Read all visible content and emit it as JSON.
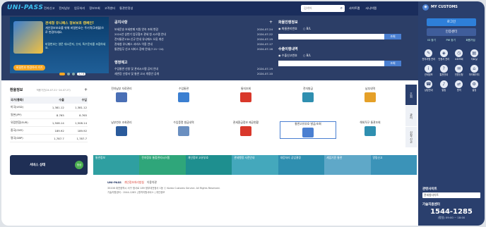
{
  "header": {
    "logo": "UNI-PASS",
    "nav": [
      "전자신고",
      "전자납부",
      "업무처리",
      "정보조회",
      "고객센터",
      "통관안정성"
    ],
    "search_placeholder": "검색어",
    "links": [
      "사이트맵",
      "시니어맵"
    ]
  },
  "promo": {
    "title": "관세청 유니패스 정보보호 캠페인!",
    "text": "개인정보보호를 위해 비밀번호는 주기적(3개월)으로 변경하세요.",
    "sub": "비밀번호는 영문 대소문자, 숫자, 특수문자를 조합하세요.",
    "button": "비밀번호 변경하러 가기",
    "pager": "1 / 3"
  },
  "notice": {
    "title": "공지사항",
    "items": [
      {
        "text": "보세운송 보세판매 지원 연속 조회 변경",
        "date": "2024-07-24"
      },
      {
        "text": "2024년 상반기 업무협조 관세 청 시스템 안내",
        "date": "2024-07-22"
      },
      {
        "text": "전자통관 EDI 신규 안내 유니패스 오류 개선",
        "date": "2024-07-19"
      },
      {
        "text": "관세청 유니패스 서비스 이용 안내",
        "date": "2024-07-17"
      },
      {
        "text": "통관업무 신고 서비스 장애 안내(7.21~24)",
        "date": "2024-07-16"
      }
    ]
  },
  "biz": {
    "title": "행정예고",
    "items": [
      {
        "text": "수입통관 신청 및 관리시스템 공지 안내",
        "date": "2024-07-19"
      },
      {
        "text": "세관장 신청서 및 통관 고시 개정안 공개",
        "date": "2024-07-10"
      }
    ]
  },
  "rates_panel": {
    "title1": "화물진행정보",
    "opts1": [
      "화물관리번호",
      "B/L"
    ],
    "go": "조회",
    "title2": "수출이행내역",
    "opts2": [
      "수출신고번호",
      "B/L"
    ]
  },
  "exchange": {
    "title": "환율정보",
    "date": "적용기간(24.07.21~24.07.27)",
    "headers": [
      "국가(통화)",
      "수출",
      "수입"
    ],
    "rows": [
      {
        "c": "미국(USD)",
        "e": "1,381.12",
        "i": "1,381.12"
      },
      {
        "c": "일본(JPY)",
        "e": "8.765",
        "i": "8.765"
      },
      {
        "c": "유럽연합(EUR)",
        "e": "1,508.14",
        "i": "1,508.14"
      },
      {
        "c": "중국(CNY)",
        "e": "189.92",
        "i": "189.92"
      },
      {
        "c": "영국(GBP)",
        "e": "1,787.7",
        "i": "1,787.7"
      }
    ]
  },
  "quick": [
    "전자납부\n자료관리",
    "수입통관",
    "통지조회",
    "전자발급",
    "납부내역",
    "납부번호\n조회관리",
    "수입증명\n발급내역",
    "관세환급정보\n제공현황",
    "통관고유부호\n발급/조회",
    "해외직구\n통관조회"
  ],
  "tabs": [
    "조회",
    "관리",
    "신청·신고"
  ],
  "service": {
    "label": "서비스 상태",
    "state": "정상"
  },
  "band": [
    "통관정보",
    "전자정부\n통합관리시스템",
    "개인정보\n고유부호",
    "관세행정\n사전안내",
    "대응처리\n공업결정",
    "세입기준\n통관",
    "알림신고"
  ],
  "sidebar": {
    "title": "MY CUSTOMS",
    "login": "로그인",
    "cert": "인증센터",
    "links": [
      "ID 찾기",
      "PW 찾기",
      "회원가입"
    ],
    "grid": [
      "전자서명\n관리",
      "인증서\n관리",
      "소요조회",
      "자료실",
      "관세정보",
      "통관안내",
      "민원신청",
      "마이페이지",
      "상담안내",
      "알림",
      "원격",
      "설정"
    ],
    "related_label": "관련사이트",
    "related_value": "관세청사이트",
    "center_label": "기술지원센터",
    "phone": "1544-1285",
    "hours": "(평일) 09:00 ~ 18:00"
  },
  "footer": {
    "brand": "UNI-PASS",
    "privacy": "개인정보처리방침",
    "terms": "이용약관",
    "addr": "35208 대전광역시 서구 청사로 189 정부대전청사 1동 ⓒ Korea Customs Service. All Rights Reserved.",
    "tel": "기술지원센터 : 1544-1285 | 원격지원서비스 | 개인정보"
  }
}
